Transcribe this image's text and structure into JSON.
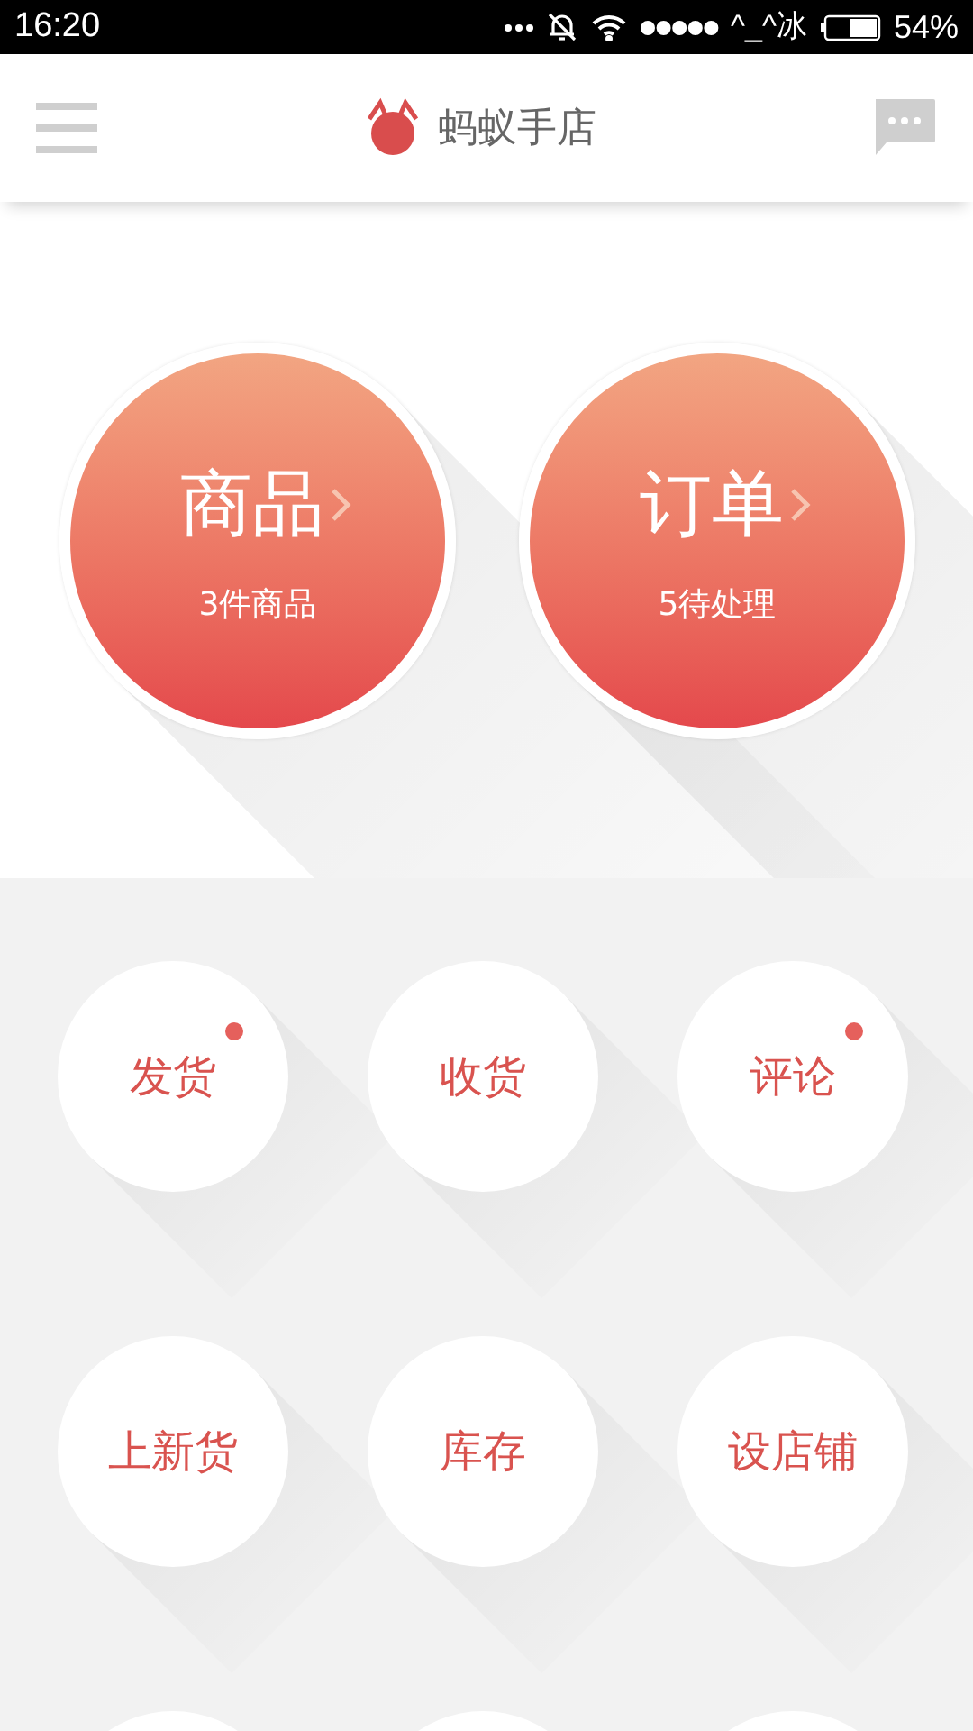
{
  "status_bar": {
    "time": "16:20",
    "carrier": "^_^冰",
    "battery": "54%"
  },
  "header": {
    "title": "蚂蚁手店"
  },
  "summary_cards": [
    {
      "title": "商品",
      "subtitle": "3件商品"
    },
    {
      "title": "订单",
      "subtitle": "5待处理"
    }
  ],
  "actions": [
    {
      "label": "发货",
      "has_dot": true
    },
    {
      "label": "收货",
      "has_dot": false
    },
    {
      "label": "评论",
      "has_dot": true
    },
    {
      "label": "上新货",
      "has_dot": false
    },
    {
      "label": "库存",
      "has_dot": false
    },
    {
      "label": "设店铺",
      "has_dot": false
    }
  ]
}
